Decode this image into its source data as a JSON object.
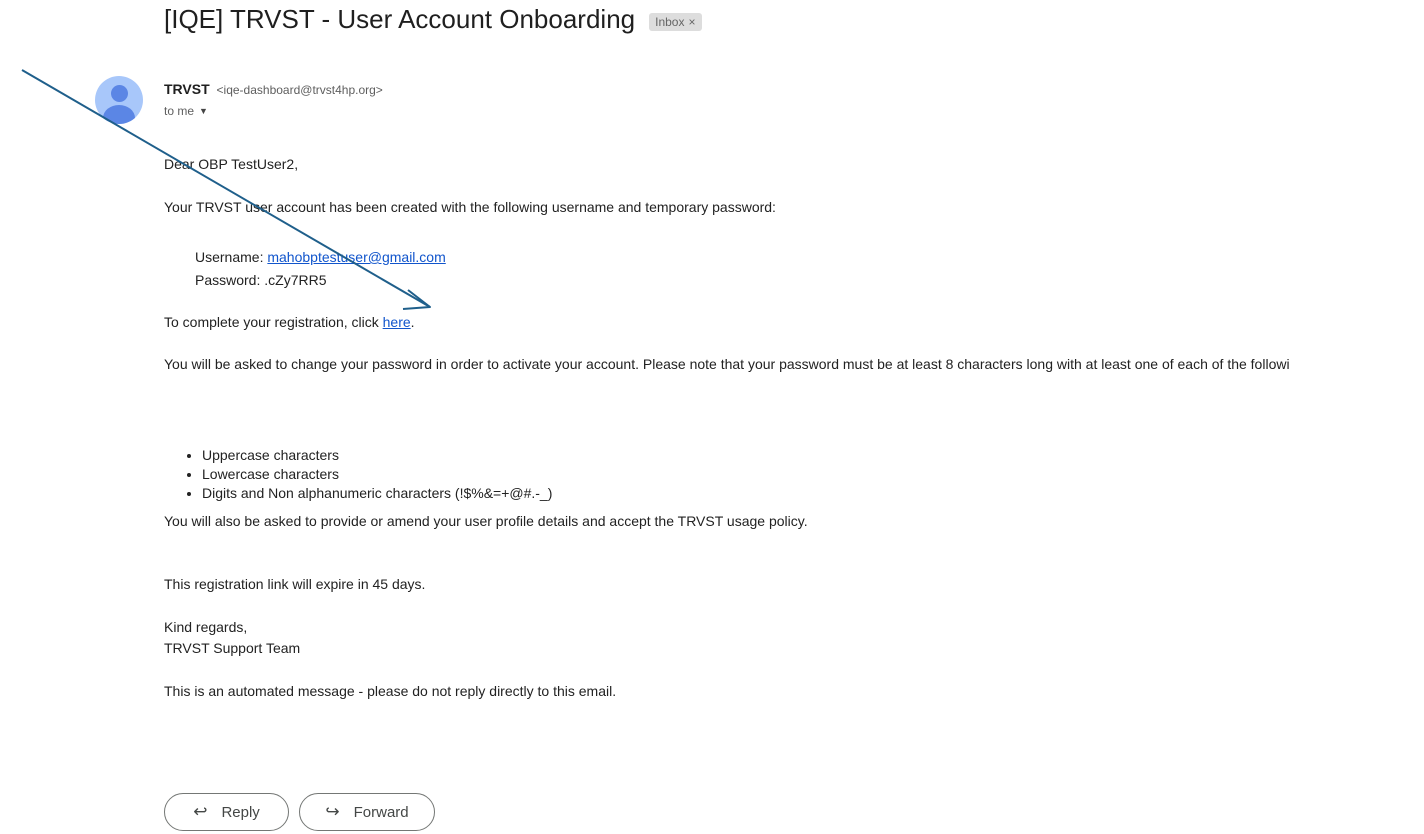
{
  "email": {
    "subject": "[IQE] TRVST - User Account Onboarding",
    "label_chip": {
      "text": "Inbox",
      "close_glyph": "×"
    },
    "sender": {
      "name": "TRVST",
      "email": "<iqe-dashboard@trvst4hp.org>"
    },
    "recipient": {
      "text": "to me",
      "caret_glyph": "▼"
    },
    "body": {
      "greeting": "Dear OBP TestUser2,",
      "intro": "Your TRVST user account has been created with the following username and temporary password:",
      "username_label": "Username: ",
      "username_value": "mahobptestuser@gmail.com",
      "password_label": "Password: ",
      "password_value": ".cZy7RR5",
      "registration_prefix": "To complete your registration, click ",
      "registration_link": "here",
      "registration_suffix": ".",
      "password_note": "You will be asked to change your password in order to activate your account. Please note that your password must be at least 8 characters long with at least one of each of the followi",
      "requirements": [
        "Uppercase characters",
        "Lowercase characters",
        "Digits and Non alphanumeric characters (!$%&=+@#.-_)"
      ],
      "profile_note": "You will also be asked to provide or amend your user profile details and accept the TRVST usage policy.",
      "expiry_note": "This registration link will expire in 45 days.",
      "closing": "Kind regards,",
      "signature": "TRVST Support Team",
      "automated_note": "This is an automated message - please do not reply directly to this email."
    },
    "actions": {
      "reply_label": "Reply",
      "reply_icon_glyph": "↩",
      "forward_label": "Forward",
      "forward_icon_glyph": "↪"
    }
  },
  "colors": {
    "link": "#1155cc",
    "annotation_arrow": "#1f5f8b",
    "avatar_bg": "#a8c7fa",
    "avatar_fg": "#5b86e5",
    "chip_bg": "#dddddd"
  },
  "icons": [
    "user-avatar-icon",
    "chevron-down-icon",
    "close-icon",
    "reply-icon",
    "forward-icon",
    "annotation-arrow-icon"
  ]
}
